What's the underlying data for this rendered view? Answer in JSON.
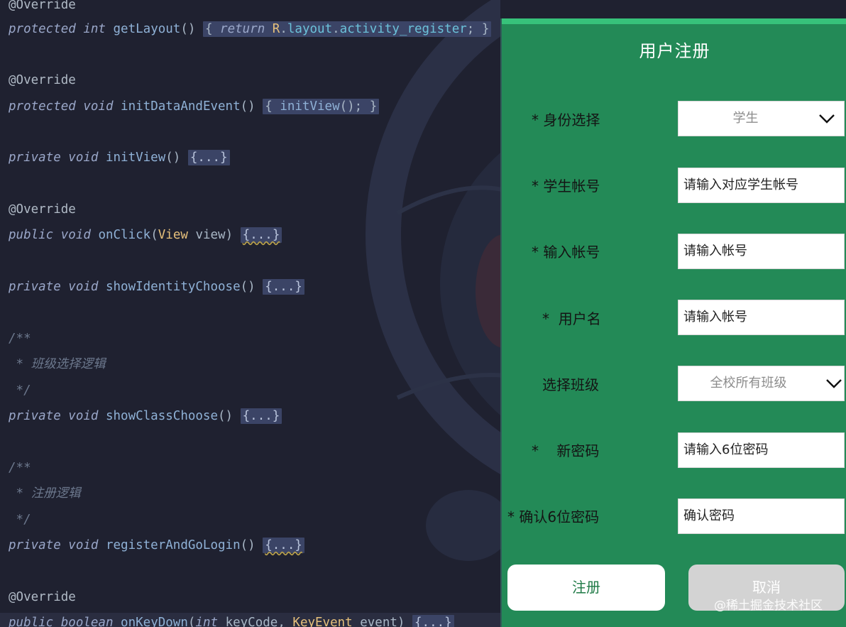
{
  "editor": {
    "lines": [
      {
        "id": "l1",
        "tokens": [
          [
            "ann",
            "@Override"
          ]
        ]
      },
      {
        "id": "l2",
        "tokens": [
          [
            "kw",
            "protected int "
          ],
          [
            "fn",
            "getLayout"
          ],
          [
            "plain",
            "() "
          ],
          [
            "fold",
            "{ "
          ],
          [
            "foldkw",
            "return "
          ],
          [
            "foldcls",
            "R"
          ],
          [
            "fold",
            "."
          ],
          [
            "foldfld",
            "layout"
          ],
          [
            "fold",
            "."
          ],
          [
            "foldfld",
            "activity_register"
          ],
          [
            "fold",
            "; }"
          ]
        ]
      },
      {
        "id": "l3",
        "tokens": []
      },
      {
        "id": "l4",
        "tokens": [
          [
            "ann",
            "@Override"
          ]
        ]
      },
      {
        "id": "l5",
        "tokens": [
          [
            "kw",
            "protected void "
          ],
          [
            "fn",
            "initDataAndEvent"
          ],
          [
            "plain",
            "() "
          ],
          [
            "fold",
            "{ "
          ],
          [
            "foldfn",
            "initView"
          ],
          [
            "fold",
            "(); }"
          ]
        ]
      },
      {
        "id": "l6",
        "tokens": []
      },
      {
        "id": "l7",
        "tokens": [
          [
            "kw",
            "private void "
          ],
          [
            "fn",
            "initView"
          ],
          [
            "plain",
            "() "
          ],
          [
            "foldbox",
            "{...}"
          ]
        ]
      },
      {
        "id": "l8",
        "tokens": []
      },
      {
        "id": "l9",
        "tokens": [
          [
            "ann",
            "@Override"
          ]
        ]
      },
      {
        "id": "l10",
        "tokens": [
          [
            "kw",
            "public void "
          ],
          [
            "fn",
            "onClick"
          ],
          [
            "plain",
            "("
          ],
          [
            "cls",
            "View"
          ],
          [
            "plain",
            " view) "
          ],
          [
            "foldboxwavy",
            "{...}"
          ]
        ]
      },
      {
        "id": "l11",
        "tokens": []
      },
      {
        "id": "l12",
        "tokens": [
          [
            "kw",
            "private void "
          ],
          [
            "fn",
            "showIdentityChoose"
          ],
          [
            "plain",
            "() "
          ],
          [
            "foldbox",
            "{...}"
          ]
        ]
      },
      {
        "id": "l13",
        "tokens": []
      },
      {
        "id": "l14",
        "tokens": [
          [
            "cmt",
            "/**"
          ]
        ]
      },
      {
        "id": "l15",
        "tokens": [
          [
            "cmt",
            " * 班级选择逻辑"
          ]
        ]
      },
      {
        "id": "l16",
        "tokens": [
          [
            "cmt",
            " */"
          ]
        ]
      },
      {
        "id": "l17",
        "tokens": [
          [
            "kw",
            "private void "
          ],
          [
            "fn",
            "showClassChoose"
          ],
          [
            "plain",
            "() "
          ],
          [
            "foldbox",
            "{...}"
          ]
        ]
      },
      {
        "id": "l18",
        "tokens": []
      },
      {
        "id": "l19",
        "tokens": [
          [
            "cmt",
            "/**"
          ]
        ]
      },
      {
        "id": "l20",
        "tokens": [
          [
            "cmt",
            " * 注册逻辑"
          ]
        ]
      },
      {
        "id": "l21",
        "tokens": [
          [
            "cmt",
            " */"
          ]
        ]
      },
      {
        "id": "l22",
        "tokens": [
          [
            "kw",
            "private void "
          ],
          [
            "fn",
            "registerAndGoLogin"
          ],
          [
            "plain",
            "() "
          ],
          [
            "foldboxwavy",
            "{...}"
          ]
        ]
      },
      {
        "id": "l23",
        "tokens": []
      },
      {
        "id": "l24",
        "tokens": [
          [
            "ann",
            "@Override"
          ]
        ]
      },
      {
        "id": "l25",
        "tokens": [
          [
            "kw",
            "public boolean "
          ],
          [
            "fn",
            "onKeyDown"
          ],
          [
            "plain",
            "("
          ],
          [
            "kw",
            "int "
          ],
          [
            "plain",
            "keyCode, "
          ],
          [
            "cls",
            "KeyEvent"
          ],
          [
            "plain",
            " event) "
          ],
          [
            "foldbox",
            "{...}"
          ]
        ]
      }
    ]
  },
  "dialog": {
    "title": "用户注册",
    "fields": [
      {
        "label": "* 身份选择",
        "type": "select",
        "value": "学生"
      },
      {
        "label": "* 学生帐号",
        "type": "input",
        "placeholder": "请输入对应学生帐号"
      },
      {
        "label": "* 输入帐号",
        "type": "input",
        "placeholder": "请输入帐号"
      },
      {
        "label": "*  用户名",
        "type": "input",
        "placeholder": "请输入帐号"
      },
      {
        "label": "选择班级",
        "type": "select",
        "value": "全校所有班级"
      },
      {
        "label": "*    新密码",
        "type": "input",
        "placeholder": "请输入6位密码"
      },
      {
        "label": "* 确认6位密码",
        "type": "input",
        "placeholder": "确认密码"
      }
    ],
    "register_label": "注册",
    "cancel_label": "取消"
  },
  "watermark": "@稀土掘金技术社区",
  "colors": {
    "dialog_bg": "#238a57",
    "dialog_accent": "#37c27a",
    "editor_bg": "#1f2130"
  }
}
